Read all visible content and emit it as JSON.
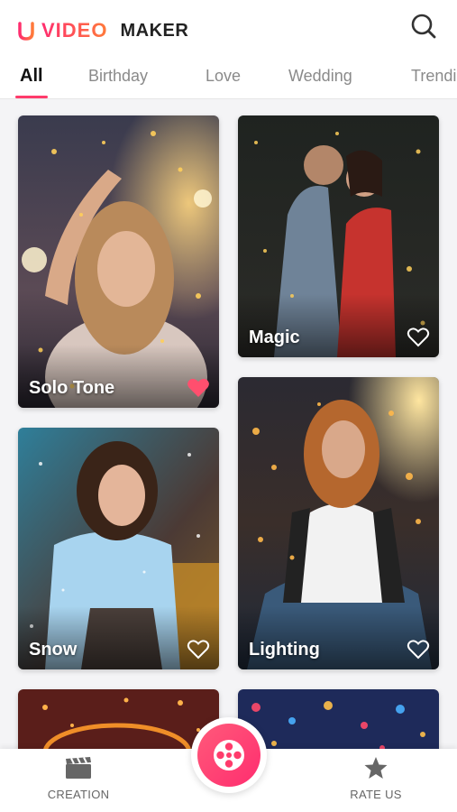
{
  "header": {
    "logo_video": "VIDEO",
    "logo_maker": "MAKER",
    "search_icon": "search-icon"
  },
  "tabs": [
    {
      "label": "All",
      "active": true
    },
    {
      "label": "Birthday",
      "active": false
    },
    {
      "label": "Love",
      "active": false
    },
    {
      "label": "Wedding",
      "active": false
    },
    {
      "label": "Trendi",
      "active": false
    }
  ],
  "cards": [
    {
      "label": "Solo Tone",
      "favorited": true
    },
    {
      "label": "Magic",
      "favorited": false
    },
    {
      "label": "Snow",
      "favorited": false
    },
    {
      "label": "Lighting",
      "favorited": false
    },
    {
      "label": "",
      "favorited": false
    },
    {
      "label": "",
      "favorited": false
    }
  ],
  "bottom_nav": {
    "creation_label": "CREATION",
    "rate_label": "RATE US",
    "center_icon": "film-reel-icon"
  },
  "colors": {
    "accent": "#ff2d6f",
    "favorite": "#ff4f6e"
  }
}
